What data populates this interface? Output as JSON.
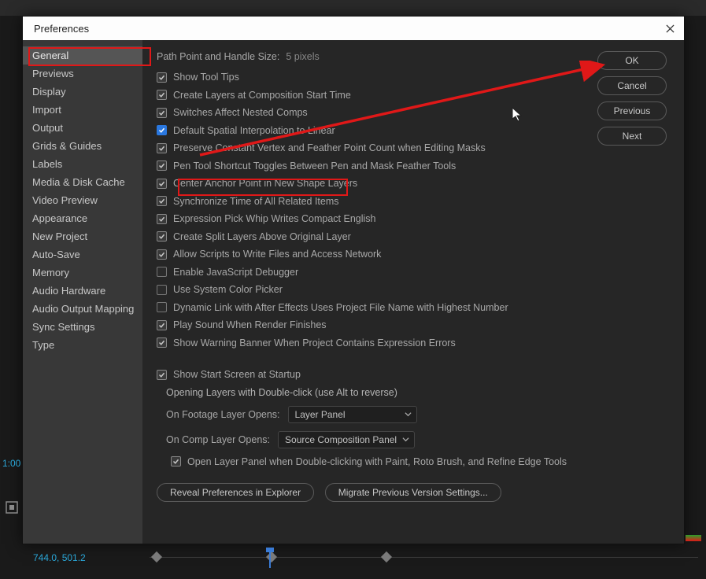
{
  "dialog": {
    "title": "Preferences"
  },
  "sidebar": {
    "items": [
      "General",
      "Previews",
      "Display",
      "Import",
      "Output",
      "Grids & Guides",
      "Labels",
      "Media & Disk Cache",
      "Video Preview",
      "Appearance",
      "New Project",
      "Auto-Save",
      "Memory",
      "Audio Hardware",
      "Audio Output Mapping",
      "Sync Settings",
      "Type"
    ],
    "selectedIndex": 0
  },
  "path": {
    "label": "Path Point and Handle Size:",
    "value": "5 pixels"
  },
  "checks": [
    {
      "label": "Show Tool Tips",
      "checked": true
    },
    {
      "label": "Create Layers at Composition Start Time",
      "checked": true
    },
    {
      "label": "Switches Affect Nested Comps",
      "checked": true
    },
    {
      "label": "Default Spatial Interpolation to Linear",
      "checked": true,
      "highlight": true
    },
    {
      "label": "Preserve Constant Vertex and Feather Point Count when Editing Masks",
      "checked": true
    },
    {
      "label": "Pen Tool Shortcut Toggles Between Pen and Mask Feather Tools",
      "checked": true
    },
    {
      "label": "Center Anchor Point in New Shape Layers",
      "checked": true
    },
    {
      "label": "Synchronize Time of All Related Items",
      "checked": true
    },
    {
      "label": "Expression Pick Whip Writes Compact English",
      "checked": true
    },
    {
      "label": "Create Split Layers Above Original Layer",
      "checked": true
    },
    {
      "label": "Allow Scripts to Write Files and Access Network",
      "checked": true
    },
    {
      "label": "Enable JavaScript Debugger",
      "checked": false
    },
    {
      "label": "Use System Color Picker",
      "checked": false
    },
    {
      "label": "Dynamic Link with After Effects Uses Project File Name with Highest Number",
      "checked": false
    },
    {
      "label": "Play Sound When Render Finishes",
      "checked": true
    },
    {
      "label": "Show Warning Banner When Project Contains Expression Errors",
      "checked": true
    }
  ],
  "startup": {
    "check": {
      "label": "Show Start Screen at Startup",
      "checked": true
    },
    "sub": "Opening Layers with Double-click (use Alt to reverse)",
    "footage": {
      "label": "On Footage Layer Opens:",
      "value": "Layer Panel"
    },
    "comp": {
      "label": "On Comp Layer Opens:",
      "value": "Source Composition Panel"
    },
    "paint": {
      "label": "Open Layer Panel when Double-clicking with Paint, Roto Brush, and Refine Edge Tools",
      "checked": true
    }
  },
  "bottom": {
    "reveal": "Reveal Preferences in Explorer",
    "migrate": "Migrate Previous Version Settings..."
  },
  "right": {
    "ok": "OK",
    "cancel": "Cancel",
    "prev": "Previous",
    "next": "Next"
  },
  "footer": {
    "coord": "744.0, 501.2",
    "ts": "1:00"
  }
}
